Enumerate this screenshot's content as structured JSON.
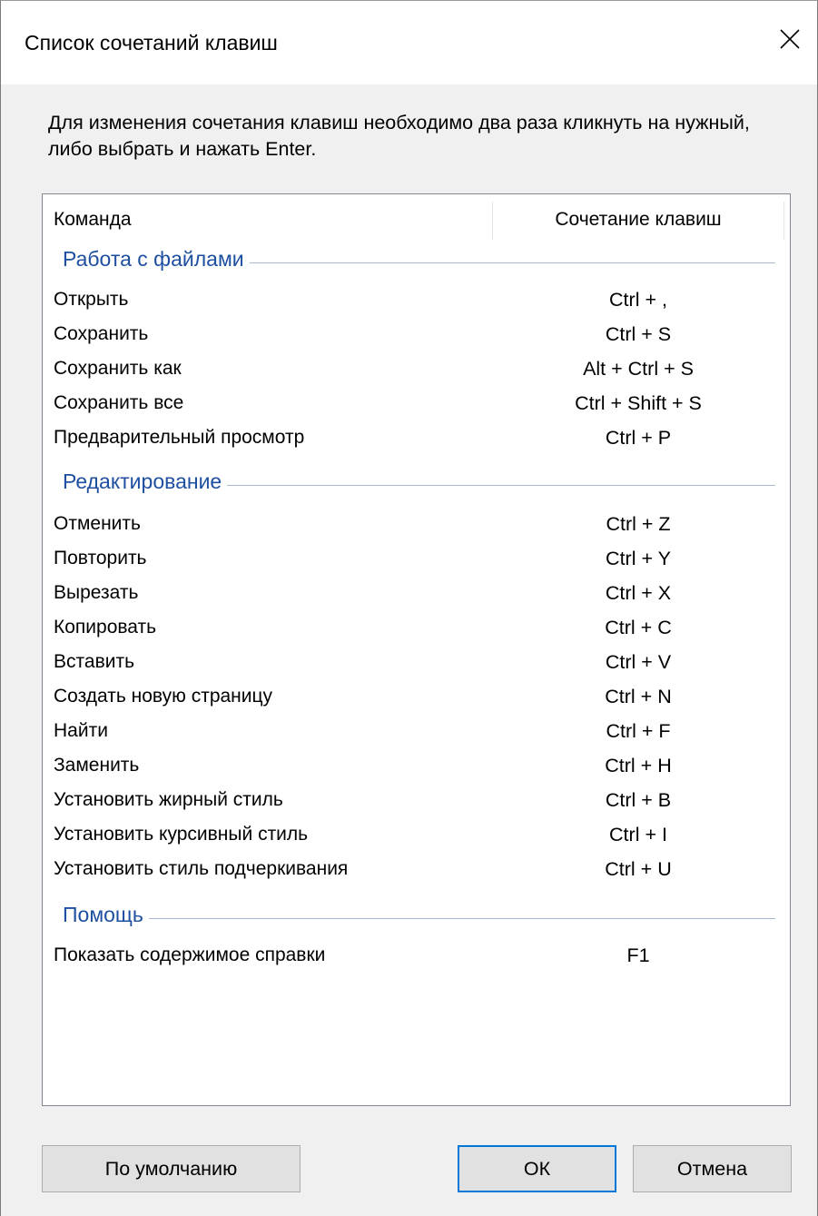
{
  "window": {
    "title": "Список сочетаний клавиш"
  },
  "instructions": "Для изменения сочетания клавиш необходимо два раза кликнуть на нужный, либо выбрать и нажать Enter.",
  "list": {
    "columns": {
      "command": "Команда",
      "shortcut": "Сочетание клавиш"
    },
    "groups": [
      {
        "title": "Работа с файлами",
        "items": [
          {
            "command": "Открыть",
            "shortcut": "Ctrl + ,"
          },
          {
            "command": "Сохранить",
            "shortcut": "Ctrl + S"
          },
          {
            "command": "Сохранить как",
            "shortcut": "Alt + Ctrl + S"
          },
          {
            "command": "Сохранить все",
            "shortcut": "Ctrl + Shift + S"
          },
          {
            "command": "Предварительный просмотр",
            "shortcut": "Ctrl + P"
          }
        ]
      },
      {
        "title": "Редактирование",
        "items": [
          {
            "command": "Отменить",
            "shortcut": "Ctrl + Z"
          },
          {
            "command": "Повторить",
            "shortcut": "Ctrl + Y"
          },
          {
            "command": "Вырезать",
            "shortcut": "Ctrl + X"
          },
          {
            "command": "Копировать",
            "shortcut": "Ctrl + C"
          },
          {
            "command": "Вставить",
            "shortcut": "Ctrl + V"
          },
          {
            "command": "Создать новую страницу",
            "shortcut": "Ctrl + N"
          },
          {
            "command": "Найти",
            "shortcut": "Ctrl + F"
          },
          {
            "command": "Заменить",
            "shortcut": "Ctrl + H"
          },
          {
            "command": "Установить жирный стиль",
            "shortcut": "Ctrl + B"
          },
          {
            "command": "Установить курсивный стиль",
            "shortcut": "Ctrl + I"
          },
          {
            "command": "Установить стиль подчеркивания",
            "shortcut": "Ctrl + U"
          }
        ]
      },
      {
        "title": "Помощь",
        "items": [
          {
            "command": "Показать содержимое справки",
            "shortcut": "F1"
          }
        ]
      }
    ]
  },
  "buttons": {
    "default_label": "По умолчанию",
    "ok_label": "ОК",
    "cancel_label": "Отмена"
  },
  "colors": {
    "group_title": "#1e4fa0",
    "focus_border": "#0078d7",
    "dialog_background": "#f0f0f0"
  },
  "icons": {
    "close": "close-icon"
  }
}
